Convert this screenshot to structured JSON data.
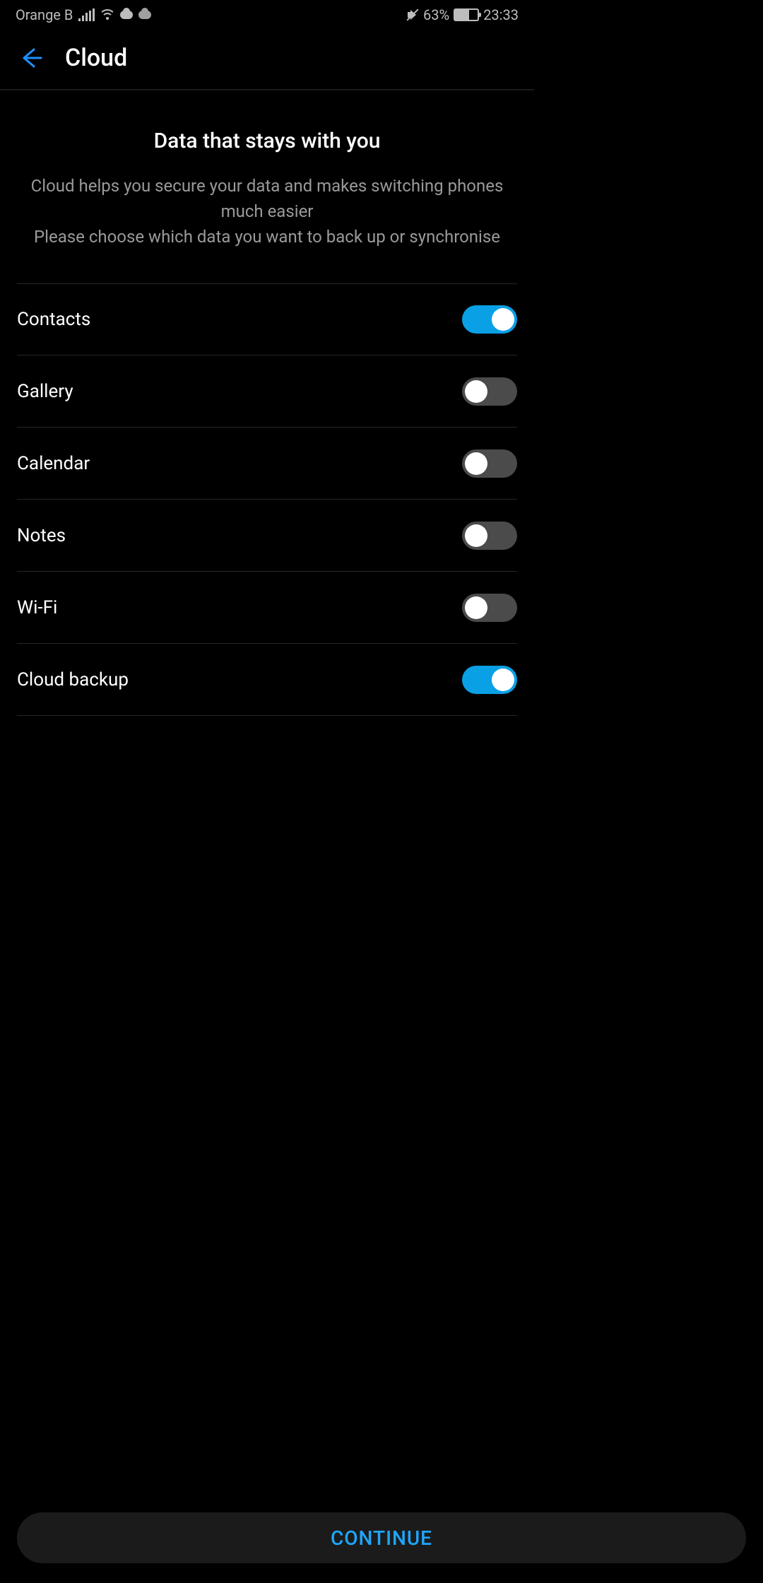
{
  "status_bar": {
    "carrier": "Orange B",
    "battery_pct": "63%",
    "time": "23:33",
    "battery_fill_pct": 63
  },
  "header": {
    "title": "Cloud"
  },
  "intro": {
    "headline": "Data that stays with you",
    "line1": "Cloud helps you secure your data and makes switching phones much easier",
    "line2": "Please choose which data you want to back up or synchronise"
  },
  "items": [
    {
      "label": "Contacts",
      "on": true
    },
    {
      "label": "Gallery",
      "on": false
    },
    {
      "label": "Calendar",
      "on": false
    },
    {
      "label": "Notes",
      "on": false
    },
    {
      "label": "Wi-Fi",
      "on": false
    },
    {
      "label": "Cloud backup",
      "on": true
    }
  ],
  "footer": {
    "continue_label": "CONTINUE"
  },
  "colors": {
    "accent": "#1ea7ff",
    "toggle_on": "#0aa0e6"
  }
}
